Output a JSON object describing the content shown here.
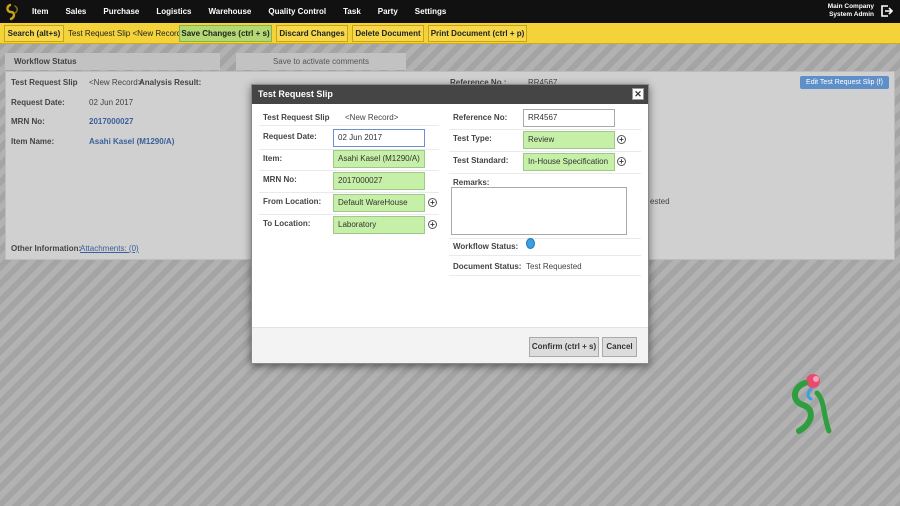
{
  "nav": {
    "items": [
      "Item",
      "Sales",
      "Purchase",
      "Logistics",
      "Warehouse",
      "Quality Control",
      "Task",
      "Party",
      "Settings"
    ],
    "company": "Main Company",
    "user": "System Admin"
  },
  "toolbar": {
    "search": "Search (alt+s)",
    "breadcrumb": "Test Request Slip <New Record>",
    "save": "Save Changes (ctrl + s)",
    "discard": "Discard Changes",
    "delete": "Delete Document",
    "print": "Print Document (ctrl + p)"
  },
  "background": {
    "workflow_tab": "Workflow Status",
    "save_comments": "Save to activate comments",
    "title": "Test Request Slip",
    "new_record": "<New Record>",
    "analysis_result": "Analysis Result:",
    "request_date_label": "Request Date:",
    "request_date": "02 Jun 2017",
    "mrn_label": "MRN No:",
    "mrn": "2017000027",
    "item_label": "Item Name:",
    "item": "Asahi Kasel (M1290/A)",
    "reference_label": "Reference No :",
    "reference": "RR4567",
    "edit_button": "Edit Test Request Slip (f)",
    "status_fragment": "ested",
    "other_info_label": "Other Information:",
    "attachments": "Attachments: (0)"
  },
  "modal": {
    "title": "Test Request Slip",
    "close": "✕",
    "record_label": "Test Request Slip",
    "record_value": "<New Record>",
    "request_date_label": "Request Date:",
    "request_date": "02 Jun 2017",
    "item_label": "Item:",
    "item": "Asahi Kasel (M1290/A)",
    "mrn_label": "MRN No:",
    "mrn": "2017000027",
    "from_label": "From Location:",
    "from": "Default WareHouse",
    "to_label": "To Location:",
    "to": "Laboratory",
    "reference_label": "Reference No:",
    "reference": "RR4567",
    "test_type_label": "Test Type:",
    "test_type": "Review",
    "test_standard_label": "Test Standard:",
    "test_standard": "In-House Specification",
    "remarks_label": "Remarks:",
    "remarks": "",
    "workflow_label": "Workflow Status:",
    "doc_status_label": "Document Status:",
    "doc_status": "Test Requested",
    "confirm": "Confirm (ctrl + s)",
    "cancel": "Cancel"
  },
  "colors": {
    "nav_bg": "#111111",
    "toolbar_bg": "#f4d23a",
    "save_green": "#b3d973",
    "field_green": "#c6f0a8",
    "workflow_dot": "#3aa0e0",
    "edit_blue": "#5f8fc8"
  }
}
